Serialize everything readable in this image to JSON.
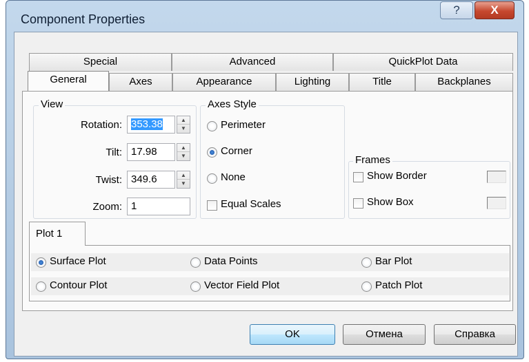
{
  "window": {
    "title": "Component Properties",
    "help_glyph": "?",
    "close_glyph": "X"
  },
  "tabs_top": [
    "Special",
    "Advanced",
    "QuickPlot Data"
  ],
  "tabs_bottom": [
    "General",
    "Axes",
    "Appearance",
    "Lighting",
    "Title",
    "Backplanes"
  ],
  "selected_tab": "General",
  "view": {
    "legend": "View",
    "rotation_label": "Rotation:",
    "rotation_value": "353.38",
    "tilt_label": "Tilt:",
    "tilt_value": "17.98",
    "twist_label": "Twist:",
    "twist_value": "349.6",
    "zoom_label": "Zoom:",
    "zoom_value": "1"
  },
  "axes_style": {
    "legend": "Axes Style",
    "options": [
      "Perimeter",
      "Corner",
      "None"
    ],
    "selected": "Corner",
    "equal_scales_label": "Equal Scales",
    "equal_scales_checked": false
  },
  "frames": {
    "legend": "Frames",
    "show_border_label": "Show Border",
    "show_border_checked": false,
    "show_box_label": "Show Box",
    "show_box_checked": false
  },
  "plot": {
    "tab_label": "Plot 1",
    "options": [
      "Surface Plot",
      "Data Points",
      "Bar Plot",
      "Contour Plot",
      "Vector Field Plot",
      "Patch Plot"
    ],
    "selected": "Surface Plot"
  },
  "buttons": {
    "ok": "OK",
    "cancel": "Отмена",
    "help": "Справка"
  },
  "colors": {
    "title_bar": "#b3cbe3",
    "close_button": "#c6482f",
    "selection": "#3399ff"
  }
}
